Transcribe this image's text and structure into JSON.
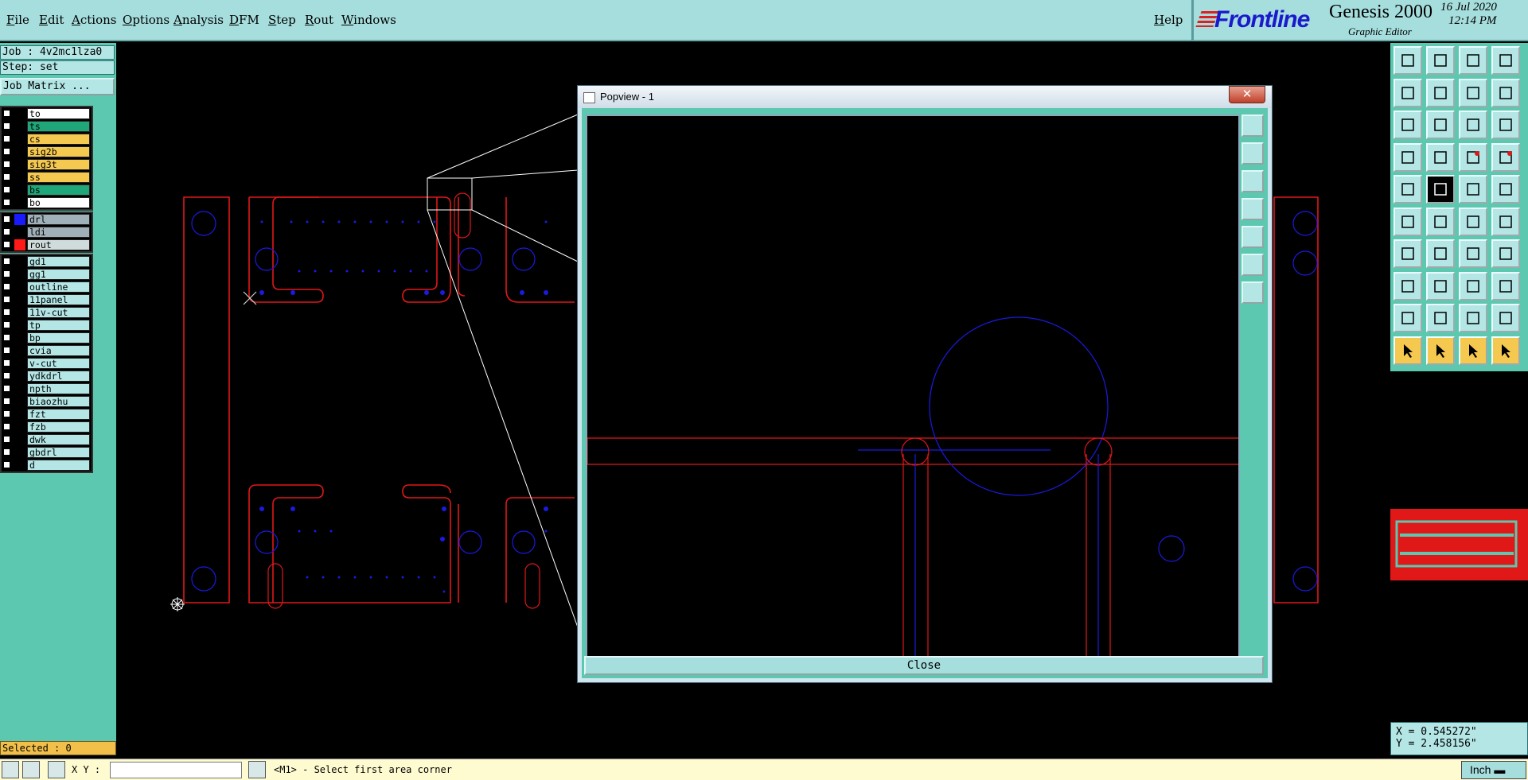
{
  "menu": {
    "items": [
      "File",
      "Edit",
      "Actions",
      "Options",
      "Analysis",
      "DFM",
      "Step",
      "Rout",
      "Windows"
    ],
    "help": "Help"
  },
  "brand": {
    "logo": "Frontline",
    "product": "Genesis 2000",
    "subtitle": "Graphic Editor",
    "date": "16 Jul 2020",
    "time": "12:14 PM"
  },
  "job": {
    "job_line": "Job : 4v2mc1lza0",
    "step_line": "Step: set",
    "matrix_button": "Job Matrix ..."
  },
  "layers": {
    "board": [
      {
        "name": "to",
        "color": "#ffffff"
      },
      {
        "name": "ts",
        "color": "#1fa77a"
      },
      {
        "name": "cs",
        "color": "#f5c850"
      },
      {
        "name": "sig2b",
        "color": "#f5c850"
      },
      {
        "name": "sig3t",
        "color": "#f5c850"
      },
      {
        "name": "ss",
        "color": "#f5c850"
      },
      {
        "name": "bs",
        "color": "#1fa77a"
      },
      {
        "name": "bo",
        "color": "#ffffff"
      }
    ],
    "drill": [
      {
        "name": "drl",
        "color": "#a0b0b8",
        "swatch": "#1a1aff"
      },
      {
        "name": "ldi",
        "color": "#a0b0b8",
        "swatch": "#000000"
      },
      {
        "name": "rout",
        "color": "#d0dcdc",
        "swatch": "#ff1a1a"
      }
    ],
    "misc": [
      "gd1",
      "gg1",
      "outline",
      "11panel",
      "11v-cut",
      "tp",
      "bp",
      "cvia",
      "v-cut",
      "ydkdrl",
      "npth",
      "biaozhu",
      "fzt",
      "fzb",
      "dwk",
      "gbdrl",
      "d"
    ]
  },
  "selected": "Selected : 0",
  "popview": {
    "title": "Popview - 1",
    "close_button": "Close"
  },
  "coords": {
    "x": "X = 0.545272\"",
    "y": "Y = 2.458156\""
  },
  "status": {
    "xy_label": "X Y :",
    "xy_value": "",
    "prompt": "<M1> - Select first area corner",
    "units": "Inch"
  },
  "colors": {
    "teal": "#5cc8b0",
    "light_teal": "#a6dede",
    "profile_red": "#e01818",
    "drill_blue": "#1a1ae0"
  }
}
